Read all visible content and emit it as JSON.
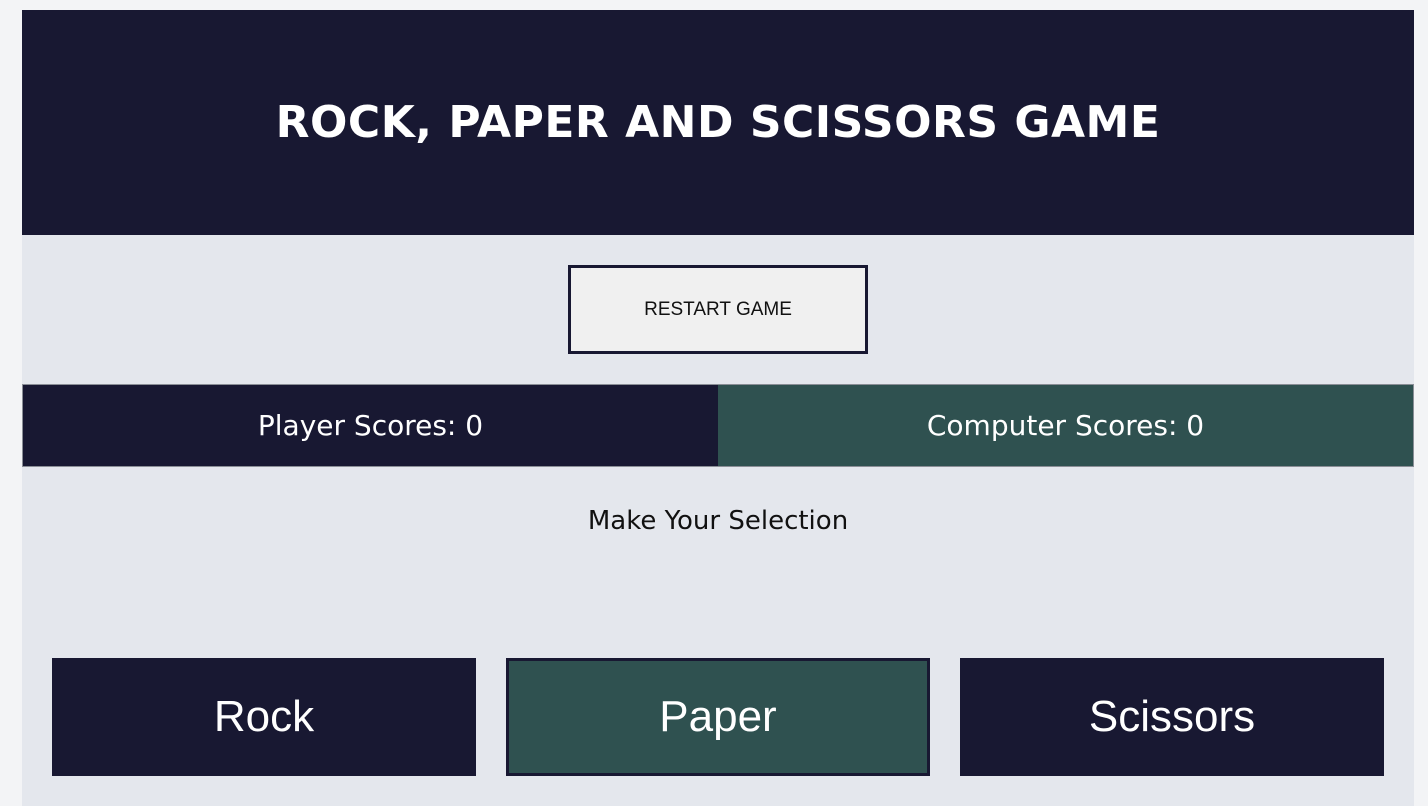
{
  "header": {
    "title": "ROCK, PAPER AND SCISSORS GAME"
  },
  "controls": {
    "restart_label": "RESTART GAME"
  },
  "scores": {
    "player_label": "Player Scores: 0",
    "computer_label": "Computer Scores: 0"
  },
  "prompt": {
    "text": "Make Your Selection"
  },
  "choices": [
    {
      "label": "Rock"
    },
    {
      "label": "Paper"
    },
    {
      "label": "Scissors"
    }
  ],
  "colors": {
    "navy": "#181832",
    "teal": "#2f5150",
    "background": "#e4e7ed"
  }
}
